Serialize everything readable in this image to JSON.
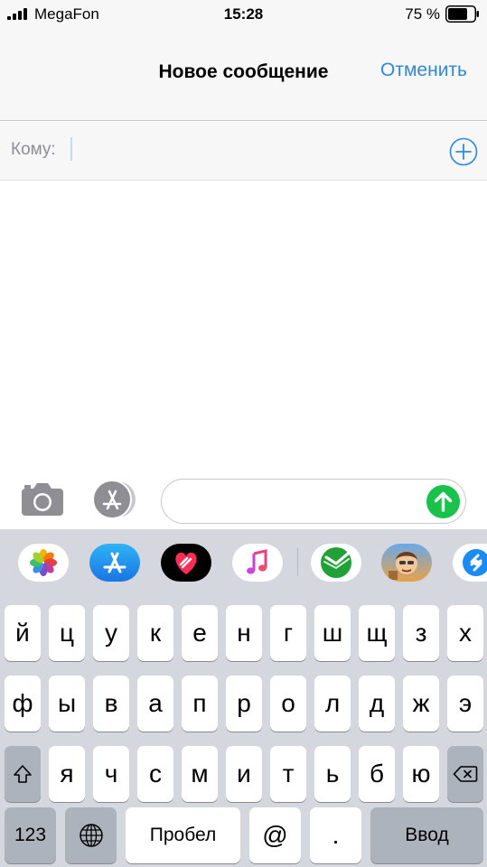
{
  "status_bar": {
    "carrier": "MegaFon",
    "time": "15:28",
    "battery_percent": "75 %",
    "battery_level": 0.75,
    "signal_bars": 4
  },
  "nav": {
    "title": "Новое сообщение",
    "cancel_label": "Отменить",
    "accent_color": "#2f8ad6"
  },
  "recipient": {
    "label": "Кому:",
    "value": "",
    "add_icon": "plus-circle-icon"
  },
  "compose": {
    "camera_icon": "camera-icon",
    "apps_icon": "app-store-icon",
    "message_value": "",
    "send_icon": "arrow-up-icon",
    "send_color": "#19c24a"
  },
  "app_drawer": {
    "apps": [
      {
        "name": "photos",
        "icon": "photos-icon"
      },
      {
        "name": "app-store",
        "icon": "app-store-icon"
      },
      {
        "name": "digital-touch",
        "icon": "heart-icon"
      },
      {
        "name": "music",
        "icon": "music-note-icon"
      },
      {
        "name": "sberbank",
        "icon": "sberbank-icon"
      },
      {
        "name": "jetpack-joyride",
        "icon": "game-icon"
      },
      {
        "name": "shazam",
        "icon": "shazam-icon"
      }
    ]
  },
  "keyboard": {
    "row1": [
      "й",
      "ц",
      "у",
      "к",
      "е",
      "н",
      "г",
      "ш",
      "щ",
      "з",
      "х"
    ],
    "row2": [
      "ф",
      "ы",
      "в",
      "а",
      "п",
      "р",
      "о",
      "л",
      "д",
      "ж",
      "э"
    ],
    "row3": [
      "я",
      "ч",
      "с",
      "м",
      "и",
      "т",
      "ь",
      "б",
      "ю"
    ],
    "numbers_label": "123",
    "space_label": "Пробел",
    "at_label": "@",
    "dot_label": ".",
    "return_label": "Ввод",
    "shift_icon": "shift-arrow-icon",
    "backspace_icon": "backspace-icon",
    "globe_icon": "globe-icon"
  }
}
